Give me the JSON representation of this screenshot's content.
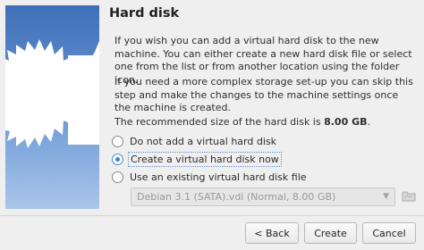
{
  "page": {
    "title": "Hard disk",
    "paragraph1": "If you wish you can add a virtual hard disk to the new machine. You can either create a new hard disk file or select one from the list or from another location using the folder icon.",
    "paragraph2": "If you need a more complex storage set-up you can skip this step and make the changes to the machine settings once the machine is created.",
    "recommended_prefix": "The recommended size of the hard disk is ",
    "recommended_size": "8.00 GB",
    "recommended_suffix": "."
  },
  "options": {
    "no_disk": "Do not add a virtual hard disk",
    "create_new": "Create a virtual hard disk now",
    "use_existing": "Use an existing virtual hard disk file",
    "selected": "create_new"
  },
  "existing_disk": {
    "selected_value": "Debian 3.1 (SATA).vdi (Normal, 8.00 GB)",
    "enabled": false
  },
  "buttons": {
    "back": "< Back",
    "create": "Create",
    "cancel": "Cancel"
  },
  "icons": {
    "banner": "wizard-star-burst-icon",
    "folder": "folder-icon",
    "dropdown": "chevron-down-icon"
  },
  "colors": {
    "banner_top": "#3f6fb8",
    "banner_bottom": "#a9c6ea",
    "radio_accent": "#3c82d4"
  }
}
